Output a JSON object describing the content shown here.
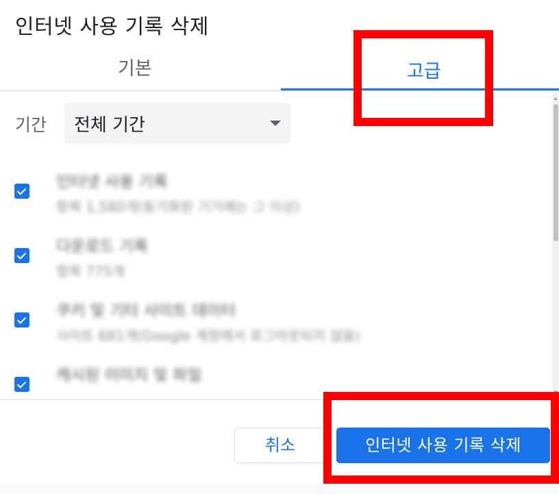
{
  "dialog": {
    "title": "인터넷 사용 기록 삭제"
  },
  "tabs": [
    {
      "label": "기본",
      "selected": false
    },
    {
      "label": "고급",
      "selected": true
    }
  ],
  "period": {
    "label": "기간",
    "value": "전체 기간"
  },
  "items": [
    {
      "title": "인터넷 사용 기록",
      "subtitle": "항목 1,580개(동기화된 기기에는 그 이상)",
      "checked": true
    },
    {
      "title": "다운로드 기록",
      "subtitle": "항목 775개",
      "checked": true
    },
    {
      "title": "쿠키 및 기타 사이트 데이터",
      "subtitle": "사이트 681개(Google 계정에서 로그아웃되지 않음)",
      "checked": true
    },
    {
      "title": "캐시된 이미지 및 파일",
      "subtitle": "",
      "checked": true
    }
  ],
  "footer": {
    "cancel_label": "취소",
    "confirm_label": "인터넷 사용 기록 삭제"
  },
  "colors": {
    "accent": "#1a73e8",
    "highlight": "#ff0000",
    "text_primary": "#202124",
    "text_secondary": "#5f6368"
  },
  "icons": {
    "checkbox": "checkbox-checked-icon",
    "dropdown": "caret-down-icon"
  }
}
